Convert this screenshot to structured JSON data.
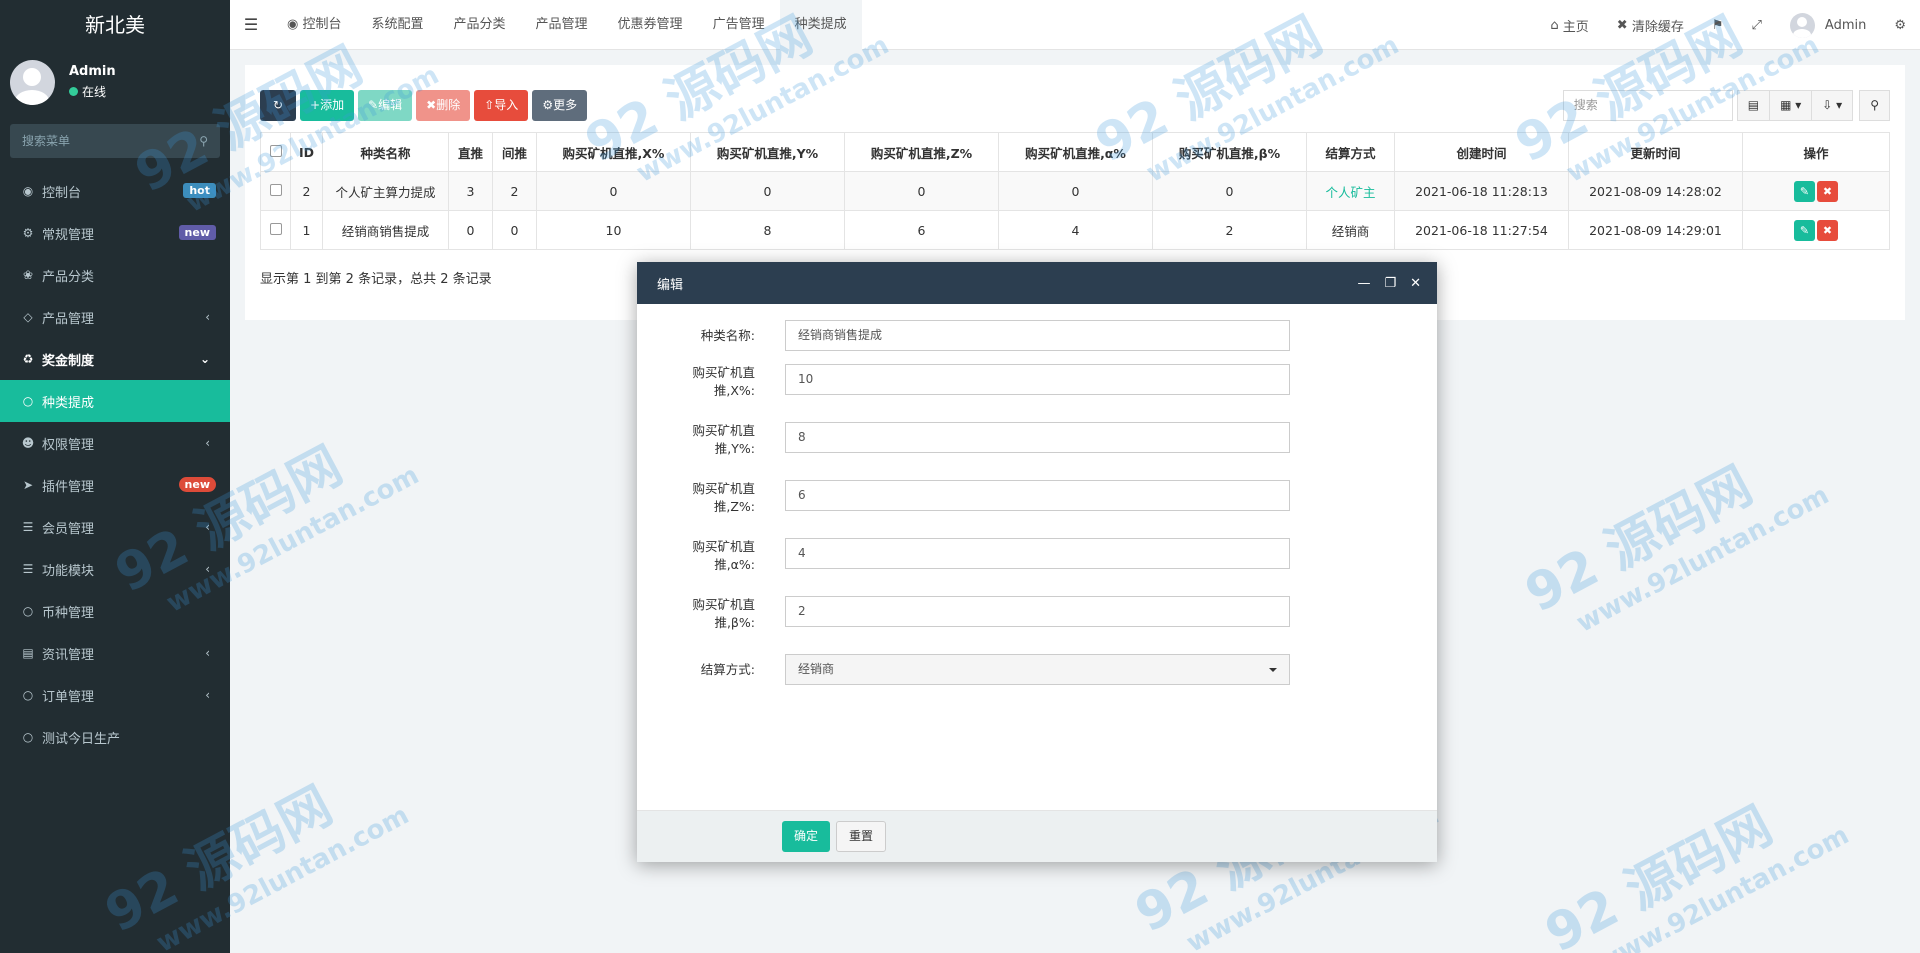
{
  "app": {
    "logo": "新北美"
  },
  "user": {
    "name": "Admin",
    "status": "在线"
  },
  "sidebar": {
    "search_placeholder": "搜索菜单",
    "items": [
      {
        "label": "控制台",
        "icon": "dashboard-icon",
        "badge": "hot"
      },
      {
        "label": "常规管理",
        "icon": "cogs-icon",
        "badge": "new"
      },
      {
        "label": "产品分类",
        "icon": "leaf-icon"
      },
      {
        "label": "产品管理",
        "icon": "diamond-icon"
      },
      {
        "label": "奖金制度",
        "icon": "recycle-icon"
      },
      {
        "label": "种类提成",
        "icon": "circle-icon"
      },
      {
        "label": "权限管理",
        "icon": "group-icon"
      },
      {
        "label": "插件管理",
        "icon": "rocket-icon",
        "badge": "new"
      },
      {
        "label": "会员管理",
        "icon": "list-icon"
      },
      {
        "label": "功能模块",
        "icon": "list-icon"
      },
      {
        "label": "币种管理",
        "icon": "circle-icon"
      },
      {
        "label": "资讯管理",
        "icon": "newspaper-icon"
      },
      {
        "label": "订单管理",
        "icon": "circle-icon"
      },
      {
        "label": "测试今日生产",
        "icon": "circle-icon"
      }
    ]
  },
  "navbar": {
    "tabs": [
      "控制台",
      "系统配置",
      "产品分类",
      "产品管理",
      "优惠券管理",
      "广告管理",
      "种类提成"
    ],
    "home": "主页",
    "clear_cache": "清除缓存",
    "user": "Admin"
  },
  "toolbar": {
    "add": "添加",
    "edit": "编辑",
    "delete": "删除",
    "import": "导入",
    "more": "更多",
    "search_placeholder": "搜索"
  },
  "table": {
    "headers": [
      "ID",
      "种类名称",
      "直推",
      "间推",
      "购买矿机直推,X%",
      "购买矿机直推,Y%",
      "购买矿机直推,Z%",
      "购买矿机直推,α%",
      "购买矿机直推,β%",
      "结算方式",
      "创建时间",
      "更新时间",
      "操作"
    ],
    "rows": [
      [
        "2",
        "个人矿主算力提成",
        "3",
        "2",
        "0",
        "0",
        "0",
        "0",
        "0",
        "个人矿主",
        "2021-06-18 11:28:13",
        "2021-08-09 14:28:02"
      ],
      [
        "1",
        "经销商销售提成",
        "0",
        "0",
        "10",
        "8",
        "6",
        "4",
        "2",
        "经销商",
        "2021-06-18 11:27:54",
        "2021-08-09 14:29:01"
      ]
    ],
    "records_text": "显示第 1 到第 2 条记录，总共 2 条记录"
  },
  "modal": {
    "title": "编辑",
    "fields": {
      "name_label": "种类名称:",
      "name_value": "经销商销售提成",
      "x_label1": "购买矿机直",
      "x_label2": "推,X%:",
      "x_value": "10",
      "y_label1": "购买矿机直",
      "y_label2": "推,Y%:",
      "y_value": "8",
      "z_label1": "购买矿机直",
      "z_label2": "推,Z%:",
      "z_value": "6",
      "a_label1": "购买矿机直",
      "a_label2": "推,α%:",
      "a_value": "4",
      "b_label1": "购买矿机直",
      "b_label2": "推,β%:",
      "b_value": "2",
      "settle_label": "结算方式:",
      "settle_value": "经销商"
    },
    "ok": "确定",
    "reset": "重置"
  },
  "watermark": {
    "main": "92 源码网",
    "url": "www.92luntan.com"
  },
  "colors": {
    "sidebar": "#222d32",
    "accent": "#18bc9c",
    "danger": "#e74c3c",
    "header_dark": "#2c3e50"
  }
}
